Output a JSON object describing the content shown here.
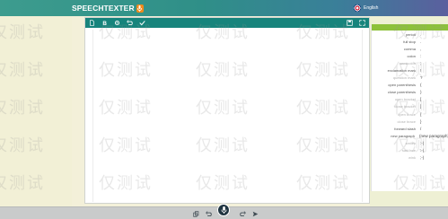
{
  "header": {
    "brand": "SPEECHTEXTER",
    "language": "English",
    "colors": {
      "bar_start": "#3d9c8e",
      "bar_end": "#5b5f9e",
      "brand_mic": "#f08a1c"
    }
  },
  "toolbar": {
    "icons": [
      "new-document-icon",
      "bold-icon",
      "settings-icon",
      "undo-icon",
      "spellcheck-icon",
      "save-icon",
      "maximize-icon"
    ],
    "color": "#17847c"
  },
  "punctuation_panel": {
    "header_color": "#8dc13a",
    "items": [
      {
        "name": "period",
        "symbol": ".",
        "greyed": false
      },
      {
        "name": "full stop",
        "symbol": ".",
        "greyed": false
      },
      {
        "name": "comma",
        "symbol": ",",
        "greyed": false
      },
      {
        "name": "colon",
        "symbol": ":",
        "greyed": false
      },
      {
        "name": "semicolon",
        "symbol": ";",
        "greyed": true
      },
      {
        "name": "exclamation mark",
        "symbol": "!",
        "greyed": false
      },
      {
        "name": "question mark",
        "symbol": "?",
        "greyed": true
      },
      {
        "name": "open parenthesis",
        "symbol": "(",
        "greyed": false
      },
      {
        "name": "close parenthesis",
        "symbol": ")",
        "greyed": false
      },
      {
        "name": "open bracket",
        "symbol": "[",
        "greyed": true
      },
      {
        "name": "close bracket",
        "symbol": "]",
        "greyed": true
      },
      {
        "name": "open brace",
        "symbol": "{",
        "greyed": true
      },
      {
        "name": "close brace",
        "symbol": "}",
        "greyed": true
      },
      {
        "name": "forward slash",
        "symbol": "/",
        "greyed": false
      },
      {
        "name": "new paragraph",
        "symbol": "(new paragraph)",
        "greyed": false
      },
      {
        "name": "smiley",
        "symbol": ":-)",
        "greyed": true
      },
      {
        "name": "sad face",
        "symbol": ":-(",
        "greyed": true
      },
      {
        "name": "wink",
        "symbol": ";-)",
        "greyed": true
      }
    ]
  },
  "bottombar": {
    "icons": [
      "copy-icon",
      "undo-icon",
      "microphone-icon",
      "redo-icon",
      "send-icon"
    ]
  },
  "watermark": "仅测试"
}
